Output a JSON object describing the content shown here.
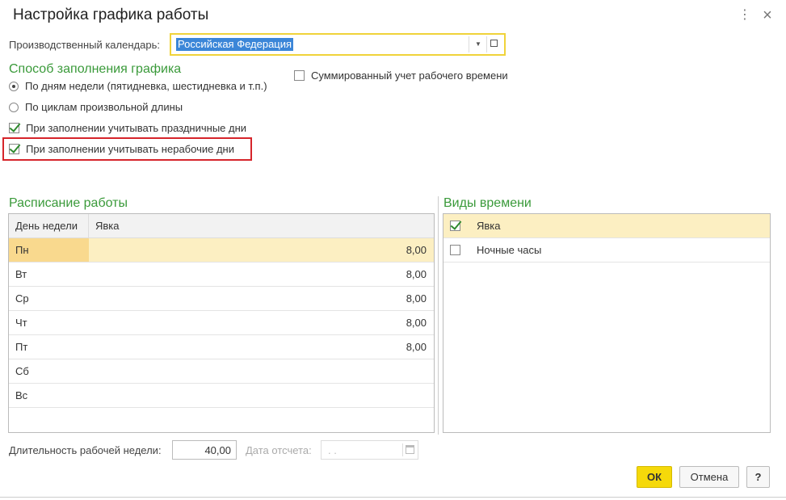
{
  "window": {
    "title": "Настройка графика работы",
    "more_icon": "⋮",
    "close_icon": "×"
  },
  "calendar": {
    "label": "Производственный календарь:",
    "value": "Российская Федерация"
  },
  "fill_method": {
    "heading": "Способ заполнения графика",
    "radio_weekdays": "По дням недели (пятидневка, шестидневка и т.п.)",
    "radio_cycles": "По циклам произвольной длины",
    "chk_holidays": "При заполнении учитывать праздничные дни",
    "chk_nonworking": "При заполнении учитывать нерабочие дни",
    "chk_summarized": "Суммированный учет рабочего времени"
  },
  "schedule": {
    "heading": "Расписание работы",
    "col_day": "День недели",
    "col_attendance": "Явка",
    "rows": [
      {
        "day": "Пн",
        "value": "8,00"
      },
      {
        "day": "Вт",
        "value": "8,00"
      },
      {
        "day": "Ср",
        "value": "8,00"
      },
      {
        "day": "Чт",
        "value": "8,00"
      },
      {
        "day": "Пт",
        "value": "8,00"
      },
      {
        "day": "Сб",
        "value": ""
      },
      {
        "day": "Вс",
        "value": ""
      }
    ]
  },
  "time_types": {
    "heading": "Виды времени",
    "items": [
      {
        "label": "Явка",
        "checked": true
      },
      {
        "label": "Ночные часы",
        "checked": false
      }
    ]
  },
  "footer": {
    "week_length_label": "Длительность рабочей недели:",
    "week_length_value": "40,00",
    "ref_date_label": "Дата отсчета:",
    "ref_date_value": " .  .",
    "ok": "ОК",
    "cancel": "Отмена",
    "help": "?"
  },
  "colors": {
    "accent_yellow": "#f5d90a",
    "section_green": "#3a9a3a",
    "highlight_red": "#d6252b",
    "row_select": "#fcefc2",
    "cell_select": "#f9d98e"
  }
}
